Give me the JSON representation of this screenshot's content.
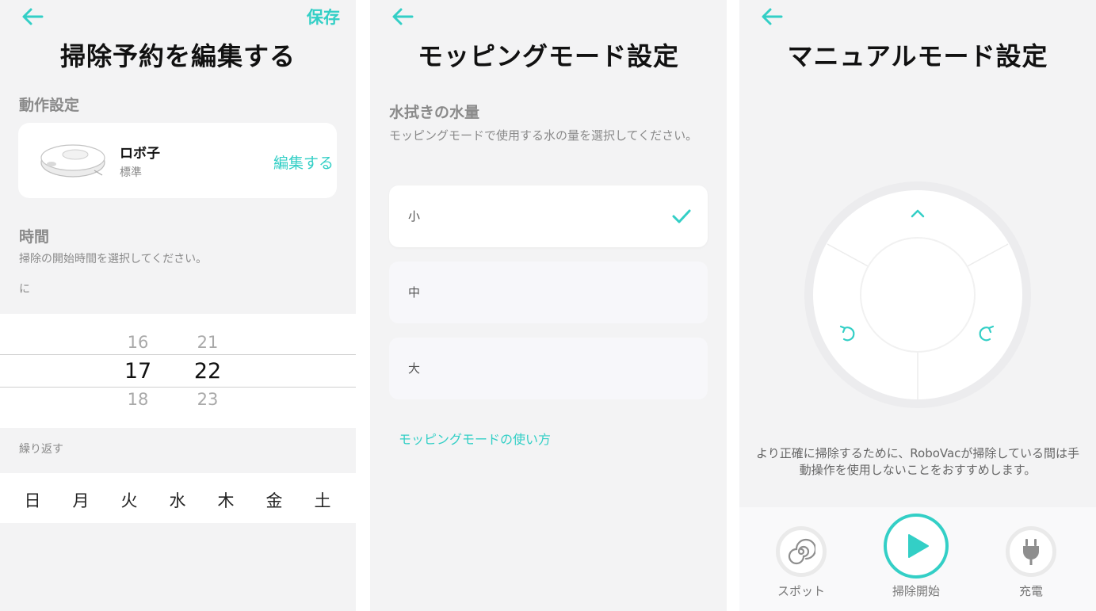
{
  "colors": {
    "accent": "#33cfc6",
    "panel_bg": "#f3f3f4",
    "card_bg": "#ffffff"
  },
  "schedule": {
    "back_icon": "arrow-left-icon",
    "save_label": "保存",
    "title": "掃除予約を編集する",
    "action_section": "動作設定",
    "robot_name": "ロボ子",
    "robot_mode": "標準",
    "edit_label": "編集する",
    "time_section": "時間",
    "time_hint": "掃除の開始時間を選択してください。",
    "time_prefix": "に",
    "picker": {
      "hours": [
        "16",
        "17",
        "18"
      ],
      "minutes": [
        "21",
        "22",
        "23"
      ],
      "selected_hour": "17",
      "selected_minute": "22"
    },
    "repeat_label": "繰り返す",
    "days": [
      "日",
      "月",
      "火",
      "水",
      "木",
      "金",
      "土"
    ]
  },
  "mopping": {
    "back_icon": "arrow-left-icon",
    "title": "モッピングモード設定",
    "water_section": "水拭きの水量",
    "water_hint": "モッピングモードで使用する水の量を選択してください。",
    "options": [
      "小",
      "中",
      "大"
    ],
    "selected_option": "小",
    "help_link": "モッピングモードの使い方"
  },
  "manual": {
    "back_icon": "arrow-left-icon",
    "title": "マニュアルモード設定",
    "note": "より正確に掃除するために、RoboVacが掃除している間は手動操作を使用しないことをおすすめします。",
    "buttons": {
      "spot": "スポット",
      "start": "掃除開始",
      "charge": "充電"
    }
  }
}
